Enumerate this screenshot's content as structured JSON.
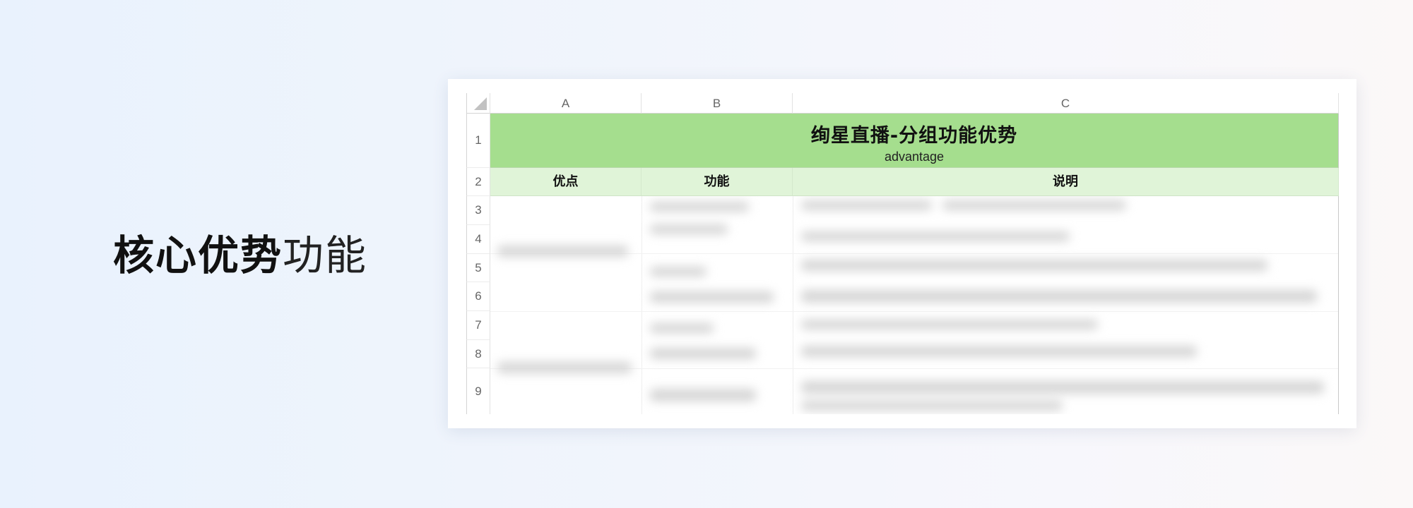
{
  "headline": {
    "bold": "核心优势",
    "light": "功能"
  },
  "spreadsheet": {
    "columns": [
      "A",
      "B",
      "C"
    ],
    "rows": [
      "1",
      "2",
      "3",
      "4",
      "5",
      "6",
      "7",
      "8",
      "9"
    ],
    "title": "绚星直播-分组功能优势",
    "subtitle": "advantage",
    "headers": {
      "a": "优点",
      "b": "功能",
      "c": "说明"
    },
    "colors": {
      "title_fill": "#a5de8e",
      "header_fill": "#e0f4d8"
    }
  }
}
